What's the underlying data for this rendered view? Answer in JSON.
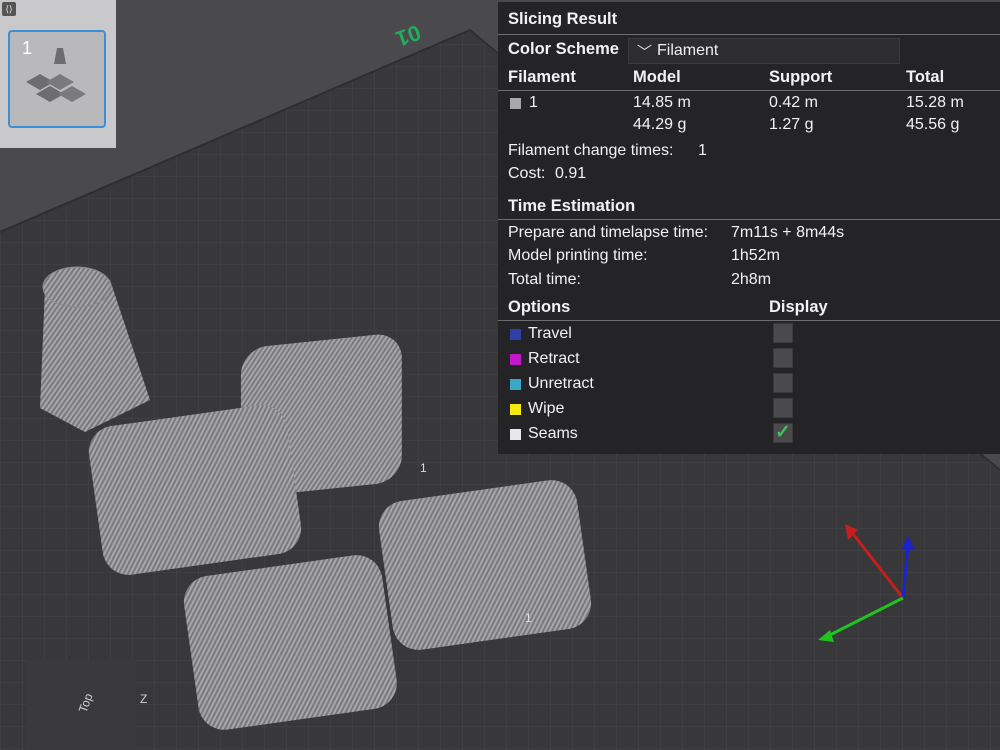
{
  "colors": {
    "travel": "#2f3fa8",
    "retract": "#c318c8",
    "unretract": "#3aa9c9",
    "wipe": "#f2ea12",
    "seams": "#e8e8e8",
    "filament_1": "#a8a8a8",
    "accent": "#3a8fd8",
    "check": "#3ec25a"
  },
  "plate": {
    "number": "1",
    "bed_label": "01"
  },
  "panel": {
    "title": "Slicing Result",
    "color_scheme_label": "Color Scheme",
    "color_scheme_value": "Filament",
    "columns": [
      "Filament",
      "Model",
      "Support",
      "Total"
    ],
    "filament_row": {
      "id": "1",
      "model_len": "14.85 m",
      "model_weight": "44.29 g",
      "support_len": "0.42 m",
      "support_weight": "1.27 g",
      "total_len": "15.28 m",
      "total_weight": "45.56 g"
    },
    "change_times_label": "Filament change times:",
    "change_times_value": "1",
    "cost_label": "Cost:",
    "cost_value": "0.91",
    "time_title": "Time Estimation",
    "prepare_label": "Prepare and timelapse time:",
    "prepare_value": "7m11s + 8m44s",
    "model_time_label": "Model printing time:",
    "model_time_value": "1h52m",
    "total_time_label": "Total time:",
    "total_time_value": "2h8m",
    "options_title": "Options",
    "display_title": "Display",
    "options": [
      {
        "label": "Travel",
        "checked": false
      },
      {
        "label": "Retract",
        "checked": false
      },
      {
        "label": "Unretract",
        "checked": false
      },
      {
        "label": "Wipe",
        "checked": false
      },
      {
        "label": "Seams",
        "checked": true
      }
    ]
  },
  "view_cube": {
    "face_label": "Top",
    "axis_label": "Z"
  },
  "model_labels": [
    "1",
    "1"
  ]
}
